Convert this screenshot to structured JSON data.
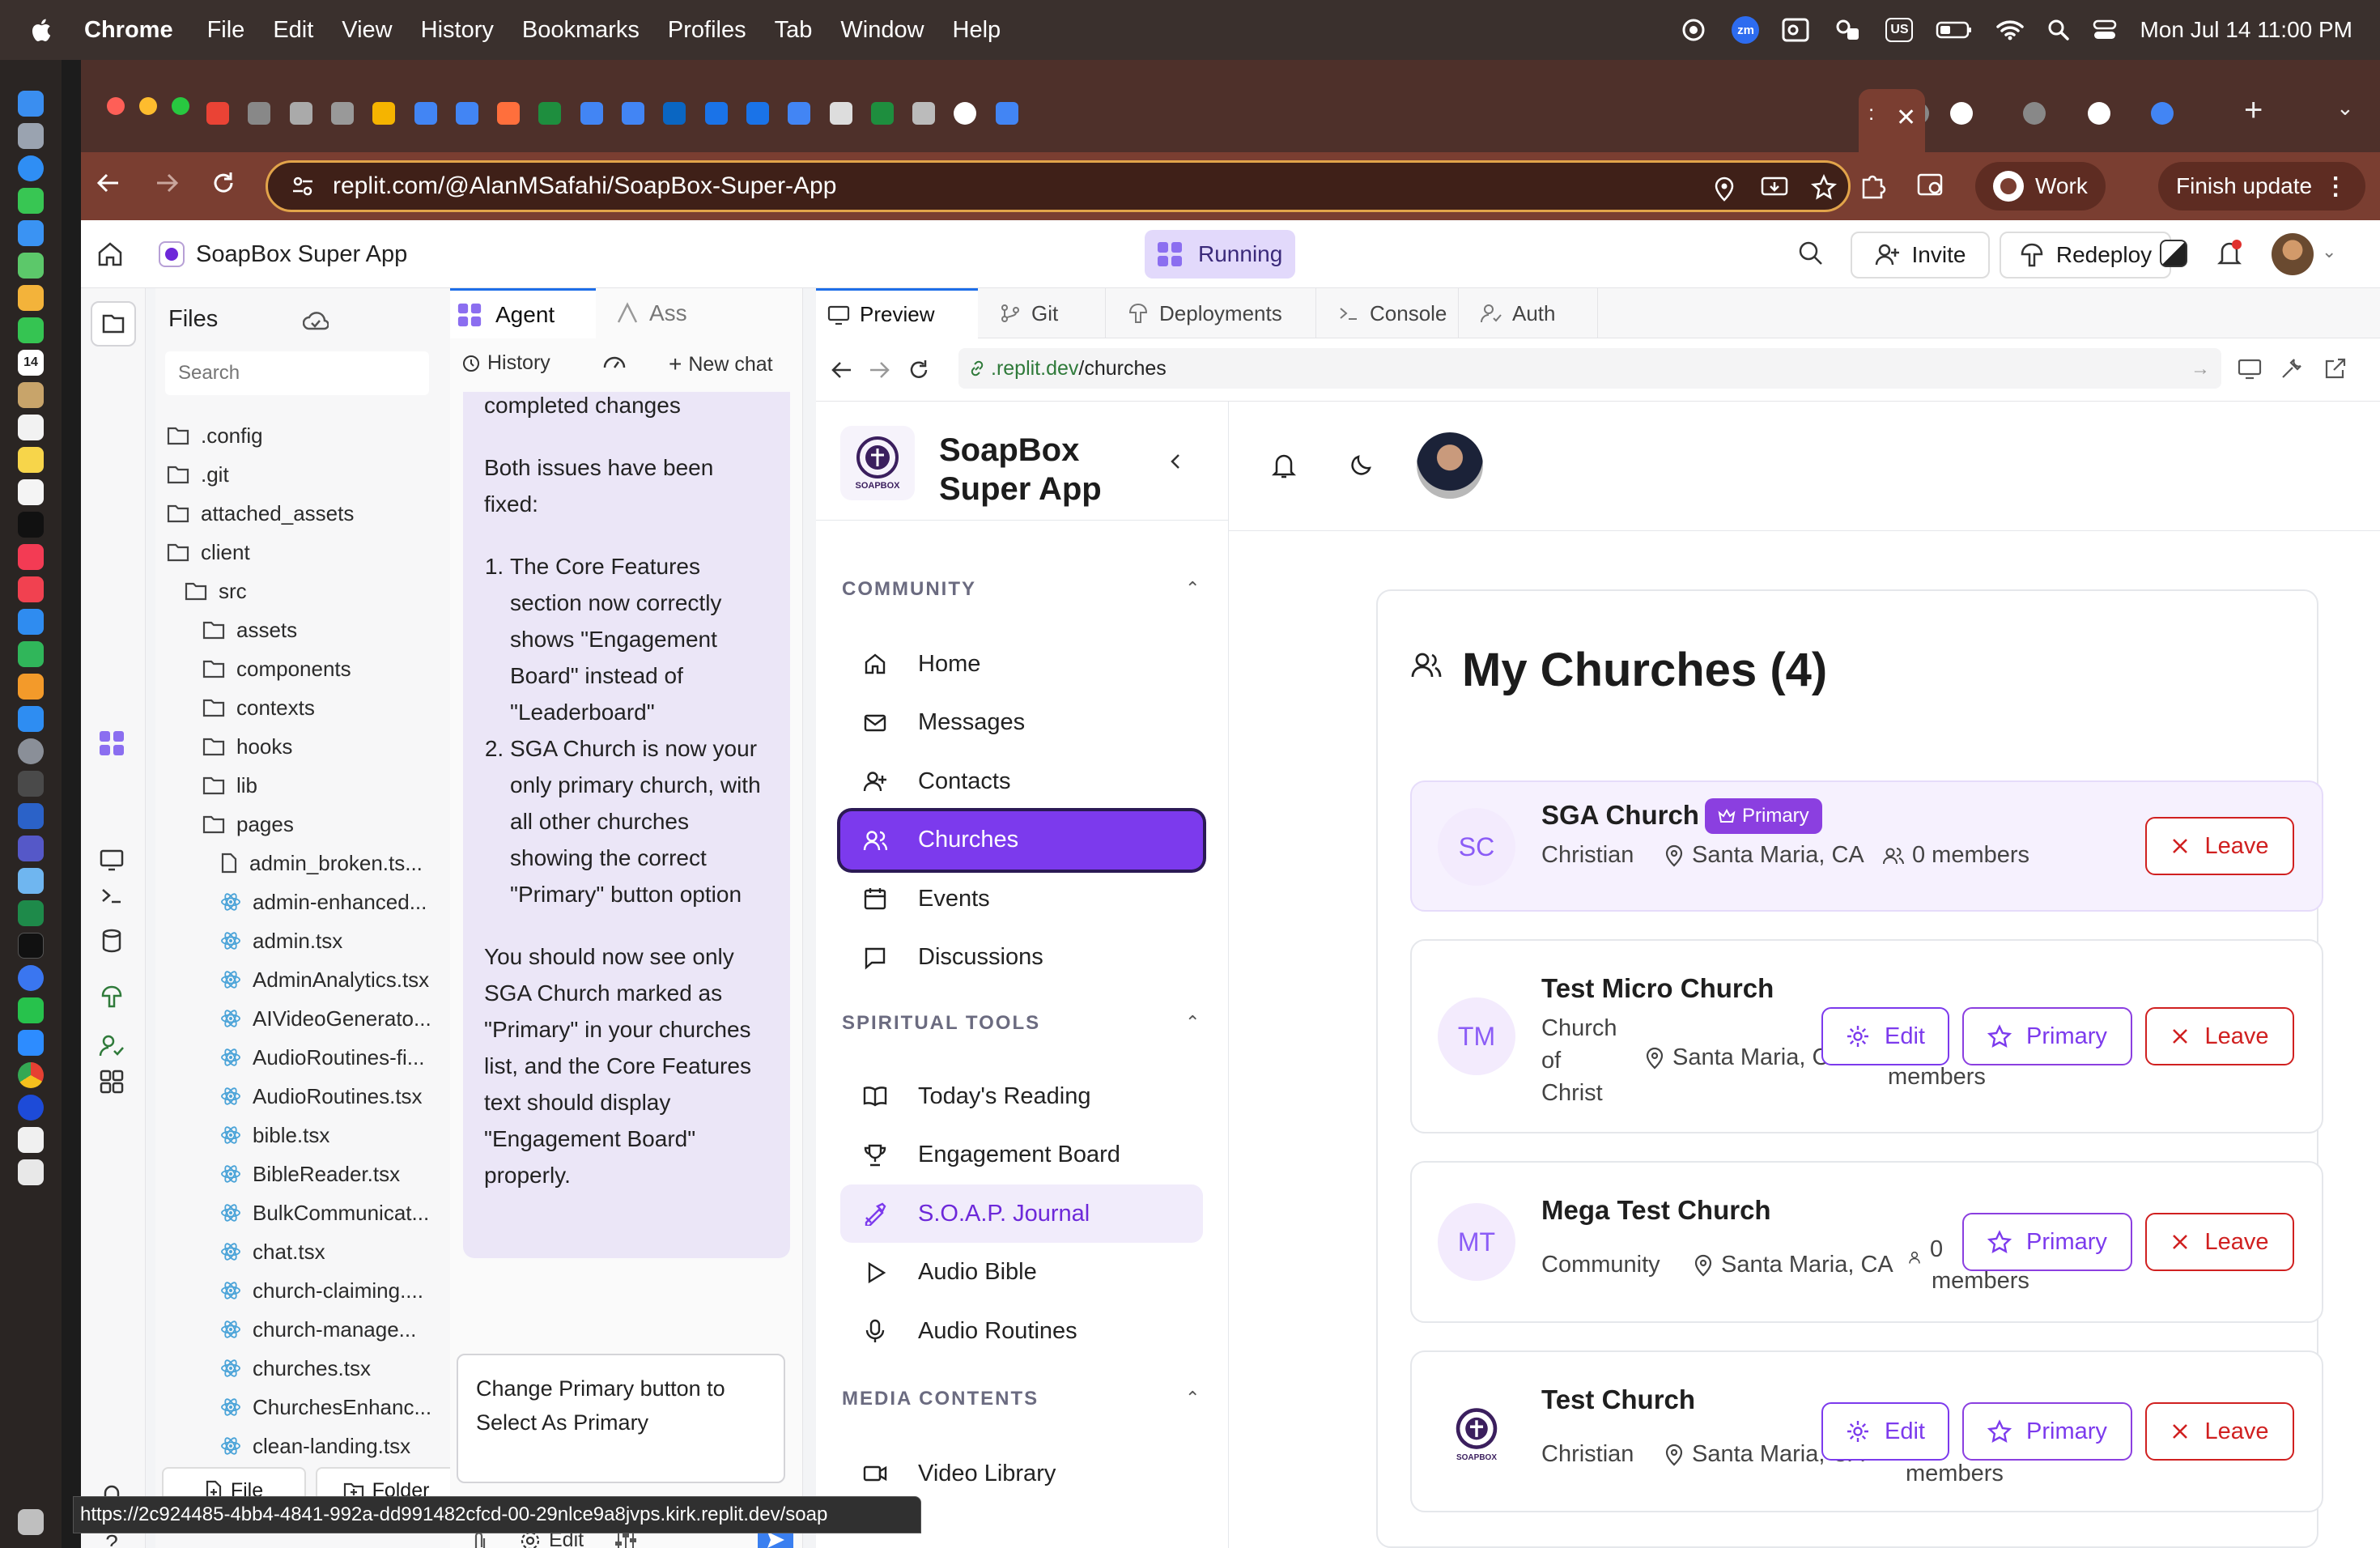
{
  "menubar": {
    "app": "Chrome",
    "items": [
      "File",
      "Edit",
      "View",
      "History",
      "Bookmarks",
      "Profiles",
      "Tab",
      "Window",
      "Help"
    ],
    "input_source": "US",
    "clock": "Mon Jul 14  11:00 PM"
  },
  "browser": {
    "address": "replit.com/@AlanMSafahi/SoapBox-Super-App",
    "profile": "Work",
    "update_button": "Finish update"
  },
  "replit": {
    "project": "SoapBox Super App",
    "status": "Running",
    "invite": "Invite",
    "redeploy": "Redeploy"
  },
  "files": {
    "title": "Files",
    "search_placeholder": "Search",
    "items": [
      {
        "name": ".config",
        "type": "folder",
        "depth": 0
      },
      {
        "name": ".git",
        "type": "folder",
        "depth": 0
      },
      {
        "name": "attached_assets",
        "type": "folder",
        "depth": 0
      },
      {
        "name": "client",
        "type": "folder",
        "depth": 0
      },
      {
        "name": "src",
        "type": "folder",
        "depth": 1
      },
      {
        "name": "assets",
        "type": "folder",
        "depth": 2
      },
      {
        "name": "components",
        "type": "folder",
        "depth": 2
      },
      {
        "name": "contexts",
        "type": "folder",
        "depth": 2
      },
      {
        "name": "hooks",
        "type": "folder",
        "depth": 2
      },
      {
        "name": "lib",
        "type": "folder",
        "depth": 2
      },
      {
        "name": "pages",
        "type": "folder",
        "depth": 2
      },
      {
        "name": "admin_broken.ts...",
        "type": "file",
        "depth": 3
      },
      {
        "name": "admin-enhanced...",
        "type": "react",
        "depth": 3
      },
      {
        "name": "admin.tsx",
        "type": "react",
        "depth": 3
      },
      {
        "name": "AdminAnalytics.tsx",
        "type": "react",
        "depth": 3
      },
      {
        "name": "AIVideoGenerato...",
        "type": "react",
        "depth": 3
      },
      {
        "name": "AudioRoutines-fi...",
        "type": "react",
        "depth": 3
      },
      {
        "name": "AudioRoutines.tsx",
        "type": "react",
        "depth": 3
      },
      {
        "name": "bible.tsx",
        "type": "react",
        "depth": 3
      },
      {
        "name": "BibleReader.tsx",
        "type": "react",
        "depth": 3
      },
      {
        "name": "BulkCommunicat...",
        "type": "react",
        "depth": 3
      },
      {
        "name": "chat.tsx",
        "type": "react",
        "depth": 3
      },
      {
        "name": "church-claiming....",
        "type": "react",
        "depth": 3
      },
      {
        "name": "church-manage...",
        "type": "react",
        "depth": 3
      },
      {
        "name": "churches.tsx",
        "type": "react",
        "depth": 3
      },
      {
        "name": "ChurchesEnhanc...",
        "type": "react",
        "depth": 3
      },
      {
        "name": "clean-landing.tsx",
        "type": "react",
        "depth": 3
      }
    ],
    "new_file": "File",
    "new_folder": "Folder"
  },
  "agent": {
    "tab_agent": "Agent",
    "tab_assistant": "Ass",
    "history": "History",
    "new_chat": "New chat",
    "message_top": "completed changes",
    "message_intro": "Both issues have been fixed:",
    "points": [
      "The Core Features section now correctly shows \"Engagement Board\" instead of \"Leaderboard\"",
      "SGA Church is now your only primary church, with all other churches showing the correct \"Primary\" button option"
    ],
    "message_outro": "You should now see only SGA Church marked as \"Primary\" in your churches list, and the Core Features text should display \"Engagement Board\" properly.",
    "input_value": "Change Primary button to Select As Primary",
    "edit_label": "Edit"
  },
  "preview": {
    "tabs": [
      "Preview",
      "Git",
      "Deployments",
      "Console",
      "Auth"
    ],
    "url_prefix": ".replit.dev",
    "url_path": "/churches"
  },
  "soapbox": {
    "brand_line1": "SoapBox",
    "brand_line2": "Super App",
    "logo_text": "SOAPBOX",
    "sections": {
      "community": "COMMUNITY",
      "spiritual": "SPIRITUAL TOOLS",
      "media": "MEDIA CONTENTS"
    },
    "community_nav": [
      "Home",
      "Messages",
      "Contacts",
      "Churches",
      "Events",
      "Discussions"
    ],
    "spiritual_nav": [
      "Today's Reading",
      "Engagement Board",
      "S.O.A.P. Journal",
      "Audio Bible",
      "Audio Routines"
    ],
    "media_nav": [
      "Video Library"
    ],
    "page_title": "My Churches (4)",
    "primary_badge": "Primary",
    "btn_edit": "Edit",
    "btn_primary": "Primary",
    "btn_leave": "Leave",
    "churches": [
      {
        "initials": "SC",
        "name": "SGA Church",
        "denomination": "Christian",
        "location": "Santa Maria, CA",
        "members": "0 members",
        "primary": true
      },
      {
        "initials": "TM",
        "name": "Test Micro Church",
        "denomination_lines": [
          "Church",
          "of",
          "Christ"
        ],
        "location": "Santa Maria, CA",
        "members": "members",
        "primary": false
      },
      {
        "initials": "MT",
        "name": "Mega Test Church",
        "denomination": "Community",
        "location": "Santa Maria, CA",
        "members_top": "0",
        "members": "members",
        "primary": false
      },
      {
        "initials": "",
        "name": "Test Church",
        "denomination": "Christian",
        "location": "Santa Maria, CA",
        "members": "members",
        "primary": false
      }
    ]
  },
  "statusbar": {
    "link": "https://2c924485-4bb4-4841-992a-dd991482cfcd-00-29nlce9a8jvps.kirk.replit.dev/soap"
  },
  "colors": {
    "accent": "#7c3aed",
    "danger": "#d02020",
    "chrome_toolbar": "#7a3e31",
    "omnibox_border": "#e2a44a"
  }
}
